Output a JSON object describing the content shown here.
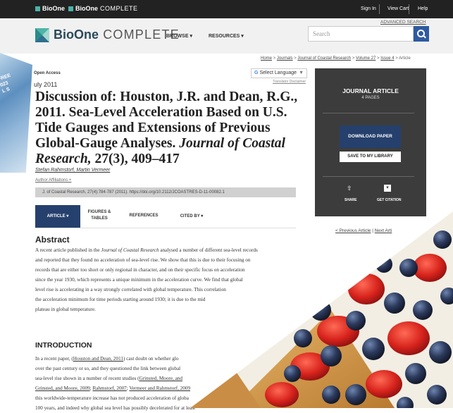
{
  "topbar": {
    "brand1": "BioOne",
    "brand2_bold": "BioOne",
    "brand2_light": " COMPLETE",
    "sign_in": "Sign In",
    "view_cart": "View Cart",
    "help": "Help"
  },
  "header": {
    "logo_bold": "BioOne",
    "logo_light": " COMPLETE",
    "nav": [
      "BROWSE ▾",
      "RESOURCES ▾"
    ],
    "advanced_search": "ADVANCED SEARCH",
    "search_placeholder": "Search"
  },
  "breadcrumb": {
    "items": [
      "Home",
      "Journals",
      "Journal of Coastal Research",
      "Volume 27",
      "Issue 4",
      "Article"
    ],
    "separator": ">"
  },
  "article": {
    "access": "Open Access",
    "date": "uly 2011",
    "select_language": "Select Language",
    "translator_disclaimer": "Translator Disclaimer",
    "title_main": "Discussion of: Houston, J.R. and Dean, R.G., 2011. Sea-Level Acceleration Based on U.S. Tide Gauges and Extensions of Previous Global-Gauge Analyses.",
    "title_journal": "Journal of Coastal Research,",
    "title_suffix": " 27(3), 409–417",
    "authors": "Stefan Rahmstorf, Martin Vermeer",
    "affiliations": "Author Affiliations +",
    "citation": "J. of Coastal Research, 27(4):784-787 (2011).  https://doi.org/10.2112/JCOASTRES-D-11-00082.1"
  },
  "tabs": [
    {
      "label": "ARTICLE ▾"
    },
    {
      "label": "FIGURES & TABLES"
    },
    {
      "label": "REFERENCES"
    },
    {
      "label": "CITED BY ▾"
    }
  ],
  "abstract": {
    "heading": "Abstract",
    "line1_pre": "A recent article published in the ",
    "line1_journal": "Journal of Coastal Research",
    "line1_post": " analysed a number of different sea-level records",
    "lines": [
      "and reported that they found no acceleration of sea-level rise. We show that this is due to their focusing on",
      "records that are either too short or only regional in character, and on their specific focus on acceleration",
      "since the year 1930, which represents a unique minimum in the acceleration curve. We find that global",
      "level rise is accelerating in a way strongly correlated with global temperature. This correlation",
      "the acceleration minimum for time periods starting around 1930; it is due to the mid",
      "plateau in global temperature."
    ]
  },
  "introduction": {
    "heading": "INTRODUCTION",
    "line1_pre": "In a recent paper, (",
    "line1_ref": "Houston and Dean, 2011",
    "line1_post": ") cast doubt on whether glo",
    "line2": "over the past century or so, and they questioned the link between global",
    "line3_pre": "sea-level rise shown in a number of recent studies (",
    "line3_ref": "Grinsted, Moore, and",
    "line4_ref1": "Grinsted, and Moore, 2009",
    "line4_ref2": "Rahmstorf, 2007",
    "line4_ref3": "Vermeer and Rahmstorf, 2009",
    "line5": "this worldwide-temperature increase has not produced acceleration of globa",
    "line6": "100 years, and indeed why global sea level has possibly decelerated for at least"
  },
  "sidebar": {
    "type": "JOURNAL ARTICLE",
    "pages": "4 PAGES",
    "download": "DOWNLOAD PAPER",
    "save": "SAVE TO MY LIBRARY",
    "share": "SHARE",
    "get_citation": "GET CITATION",
    "prev": "< Previous Article",
    "next": "Next Arti"
  },
  "overlay": {
    "text_lines": [
      "FREE",
      "023",
      "L S"
    ]
  },
  "colors": {
    "topbar": "#222222",
    "header": "#f1f1f1",
    "accent_navy": "#26406d",
    "search_blue": "#2e5aa0",
    "panel": "#3c3c3c",
    "logo_teal": "#2a8a8a"
  }
}
